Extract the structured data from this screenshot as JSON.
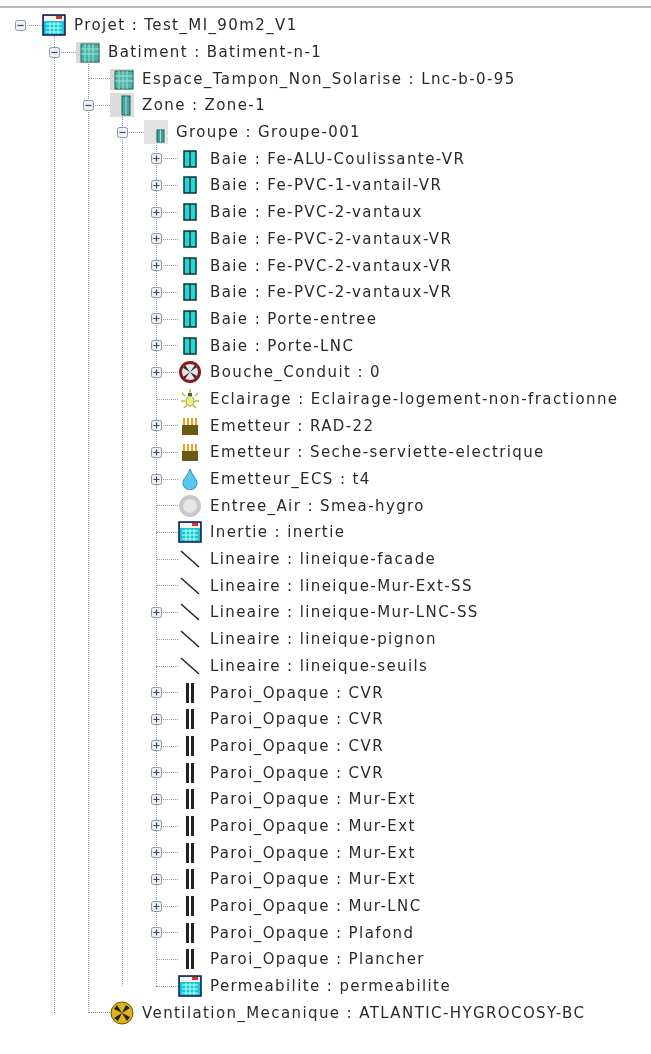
{
  "tree": [
    {
      "label": "Projet : Test_MI_90m2_V1",
      "kind": "project",
      "expanded": true,
      "children": [
        {
          "label": "Batiment : Batiment-n-1",
          "kind": "building",
          "expanded": true,
          "children": [
            {
              "label": "Espace_Tampon_Non_Solarise : Lnc-b-0-95",
              "kind": "building"
            },
            {
              "label": "Zone : Zone-1",
              "kind": "zone",
              "expanded": true,
              "children": [
                {
                  "label": "Groupe : Groupe-001",
                  "kind": "group",
                  "expanded": true,
                  "children": [
                    {
                      "label": "Baie : Fe-ALU-Coulissante-VR",
                      "kind": "window",
                      "expanded": false
                    },
                    {
                      "label": "Baie : Fe-PVC-1-vantail-VR",
                      "kind": "window",
                      "expanded": false
                    },
                    {
                      "label": "Baie : Fe-PVC-2-vantaux",
                      "kind": "window",
                      "expanded": false
                    },
                    {
                      "label": "Baie : Fe-PVC-2-vantaux-VR",
                      "kind": "window",
                      "expanded": false
                    },
                    {
                      "label": "Baie : Fe-PVC-2-vantaux-VR",
                      "kind": "window",
                      "expanded": false
                    },
                    {
                      "label": "Baie : Fe-PVC-2-vantaux-VR",
                      "kind": "window",
                      "expanded": false
                    },
                    {
                      "label": "Baie : Porte-entree",
                      "kind": "window",
                      "expanded": false
                    },
                    {
                      "label": "Baie : Porte-LNC",
                      "kind": "window",
                      "expanded": false
                    },
                    {
                      "label": "Bouche_Conduit : 0",
                      "kind": "vent",
                      "expanded": false
                    },
                    {
                      "label": "Eclairage : Eclairage-logement-non-fractionne",
                      "kind": "light"
                    },
                    {
                      "label": "Emetteur : RAD-22",
                      "kind": "radiator",
                      "expanded": false
                    },
                    {
                      "label": "Emetteur : Seche-serviette-electrique",
                      "kind": "radiator",
                      "expanded": false
                    },
                    {
                      "label": "Emetteur_ECS : t4",
                      "kind": "drop",
                      "expanded": false
                    },
                    {
                      "label": "Entree_Air : Smea-hygro",
                      "kind": "disc"
                    },
                    {
                      "label": "Inertie : inertie",
                      "kind": "project"
                    },
                    {
                      "label": "Lineaire : lineique-facade",
                      "kind": "line"
                    },
                    {
                      "label": "Lineaire : lineique-Mur-Ext-SS",
                      "kind": "line"
                    },
                    {
                      "label": "Lineaire : lineique-Mur-LNC-SS",
                      "kind": "line",
                      "expanded": false
                    },
                    {
                      "label": "Lineaire : lineique-pignon",
                      "kind": "line"
                    },
                    {
                      "label": "Lineaire : lineique-seuils",
                      "kind": "line"
                    },
                    {
                      "label": "Paroi_Opaque : CVR",
                      "kind": "wall",
                      "expanded": false
                    },
                    {
                      "label": "Paroi_Opaque : CVR",
                      "kind": "wall",
                      "expanded": false
                    },
                    {
                      "label": "Paroi_Opaque : CVR",
                      "kind": "wall",
                      "expanded": false
                    },
                    {
                      "label": "Paroi_Opaque : CVR",
                      "kind": "wall",
                      "expanded": false
                    },
                    {
                      "label": "Paroi_Opaque : Mur-Ext",
                      "kind": "wall",
                      "expanded": false
                    },
                    {
                      "label": "Paroi_Opaque : Mur-Ext",
                      "kind": "wall",
                      "expanded": false
                    },
                    {
                      "label": "Paroi_Opaque : Mur-Ext",
                      "kind": "wall",
                      "expanded": false
                    },
                    {
                      "label": "Paroi_Opaque : Mur-Ext",
                      "kind": "wall",
                      "expanded": false
                    },
                    {
                      "label": "Paroi_Opaque : Mur-LNC",
                      "kind": "wall",
                      "expanded": false
                    },
                    {
                      "label": "Paroi_Opaque : Plafond",
                      "kind": "wall",
                      "expanded": false
                    },
                    {
                      "label": "Paroi_Opaque : Plancher",
                      "kind": "wall"
                    },
                    {
                      "label": "Permeabilite : permeabilite",
                      "kind": "project"
                    }
                  ]
                }
              ]
            },
            {
              "label": "Ventilation_Mecanique : ATLANTIC-HYGROCOSY-BC",
              "kind": "fan"
            }
          ]
        }
      ]
    }
  ]
}
